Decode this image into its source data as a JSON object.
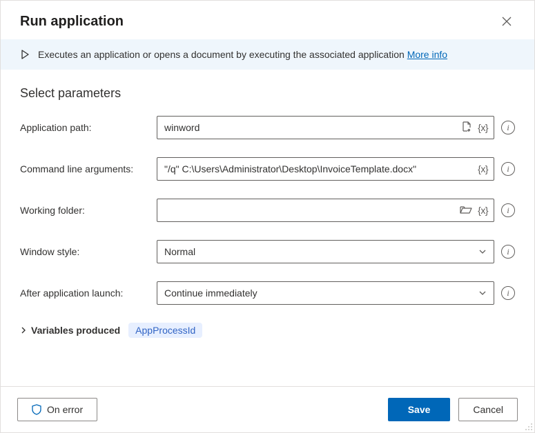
{
  "header": {
    "title": "Run application"
  },
  "info": {
    "text": "Executes an application or opens a document by executing the associated application",
    "more_link": "More info"
  },
  "section_title": "Select parameters",
  "fields": {
    "app_path": {
      "label": "Application path:",
      "value": "winword"
    },
    "cmd_args": {
      "label": "Command line arguments:",
      "value": "\"/q\" C:\\Users\\Administrator\\Desktop\\InvoiceTemplate.docx\""
    },
    "work_folder": {
      "label": "Working folder:",
      "value": ""
    },
    "window_style": {
      "label": "Window style:",
      "value": "Normal"
    },
    "after_launch": {
      "label": "After application launch:",
      "value": "Continue immediately"
    }
  },
  "variables": {
    "label": "Variables produced",
    "pill": "AppProcessId"
  },
  "footer": {
    "on_error": "On error",
    "save": "Save",
    "cancel": "Cancel"
  }
}
